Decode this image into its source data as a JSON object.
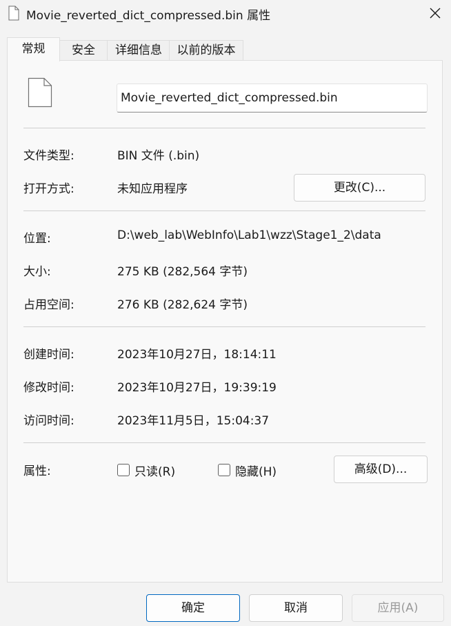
{
  "window": {
    "title": "Movie_reverted_dict_compressed.bin 属性",
    "close_icon": "close-icon",
    "file_icon": "document-icon"
  },
  "tabs": [
    {
      "label": "常规",
      "active": true
    },
    {
      "label": "安全",
      "active": false
    },
    {
      "label": "详细信息",
      "active": false
    },
    {
      "label": "以前的版本",
      "active": false
    }
  ],
  "general": {
    "file_name": "Movie_reverted_dict_compressed.bin",
    "file_type_label": "文件类型:",
    "file_type_value": "BIN 文件 (.bin)",
    "open_with_label": "打开方式:",
    "open_with_value": "未知应用程序",
    "change_button": "更改(C)...",
    "location_label": "位置:",
    "location_value": "D:\\web_lab\\WebInfo\\Lab1\\wzz\\Stage1_2\\data",
    "size_label": "大小:",
    "size_value": "275 KB (282,564 字节)",
    "size_on_disk_label": "占用空间:",
    "size_on_disk_value": "276 KB (282,624 字节)",
    "created_label": "创建时间:",
    "created_value": "2023年10月27日，18:14:11",
    "modified_label": "修改时间:",
    "modified_value": "2023年10月27日，19:39:19",
    "accessed_label": "访问时间:",
    "accessed_value": "2023年11月5日，15:04:37",
    "attributes_label": "属性:",
    "readonly_label": "只读(R)",
    "readonly_checked": false,
    "hidden_label": "隐藏(H)",
    "hidden_checked": false,
    "advanced_button": "高级(D)..."
  },
  "footer": {
    "ok_button": "确定",
    "cancel_button": "取消",
    "apply_button": "应用(A)",
    "apply_enabled": false
  },
  "colors": {
    "background": "#f3f3f3",
    "panel": "#f9f9f9",
    "accent": "#0067c0"
  }
}
